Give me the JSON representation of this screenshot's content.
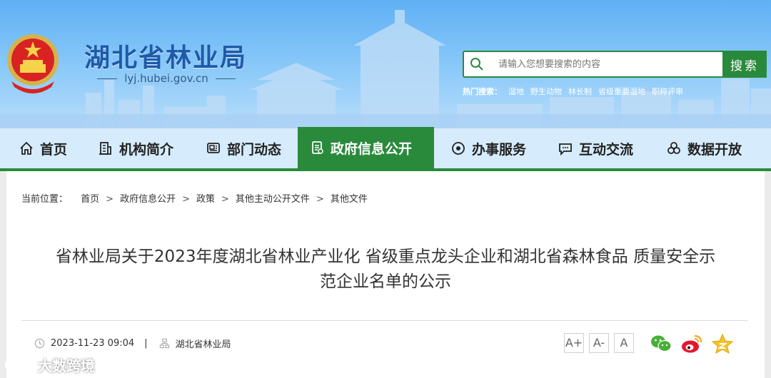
{
  "header": {
    "site_title": "湖北省林业局",
    "site_domain": "lyj.hubei.gov.cn",
    "search": {
      "placeholder": "请输入您想要搜索的内容",
      "button_label": "搜索"
    },
    "hot_search": {
      "label": "热门搜索：",
      "items": [
        "湿地",
        "野生动物",
        "林长制",
        "省级重要湿地",
        "职称评审"
      ]
    }
  },
  "nav": {
    "items": [
      {
        "label": "首页",
        "icon": "home-icon"
      },
      {
        "label": "机构简介",
        "icon": "building-icon"
      },
      {
        "label": "部门动态",
        "icon": "news-icon"
      },
      {
        "label": "政府信息公开",
        "icon": "document-icon",
        "active": true
      },
      {
        "label": "办事服务",
        "icon": "service-icon"
      },
      {
        "label": "互动交流",
        "icon": "chat-icon"
      },
      {
        "label": "数据开放",
        "icon": "data-icon"
      }
    ],
    "active_color": "#2a8a3c"
  },
  "breadcrumb": {
    "label": "当前位置：",
    "items": [
      "首页",
      "政府信息公开",
      "政策",
      "其他主动公开文件",
      "其他文件"
    ]
  },
  "article": {
    "title_line1": "省林业局关于2023年度湖北省林业产业化 省级重点龙头企业和湖北省森林食品 质量安全示",
    "title_line2": "范企业名单的公示",
    "date": "2023-11-23 09:04",
    "separator": "|",
    "source": "湖北省林业局",
    "font_sizes": [
      "A+",
      "A-",
      "A"
    ],
    "share_icons": [
      "wechat-icon",
      "weibo-icon",
      "qzone-icon"
    ]
  },
  "watermark": {
    "text": "大数跨境"
  }
}
